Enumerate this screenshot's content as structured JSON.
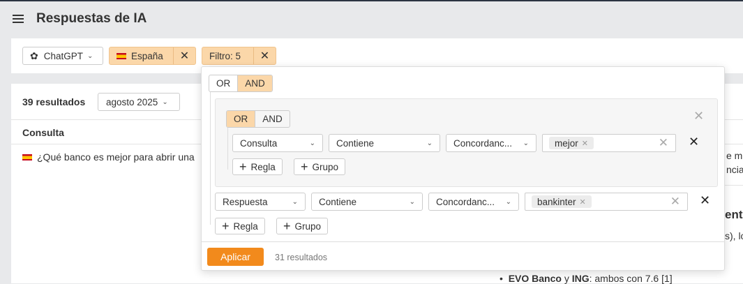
{
  "header": {
    "title": "Respuestas de IA"
  },
  "filters": {
    "model": "ChatGPT",
    "country": "España",
    "filter_label": "Filtro: 5"
  },
  "results": {
    "count": "39 resultados",
    "month": "agosto 2025",
    "column": "Consulta",
    "row_query": "¿Qué banco es mejor para abrir una"
  },
  "background_fragments": {
    "a": "e mu",
    "b": "ncia",
    "c": "ente",
    "d": "s), lo",
    "e_bold1": "EVO Banco",
    "e_mid": " y ",
    "e_bold2": "ING",
    "e_rest": ": ambos con 7.6 [1]"
  },
  "popover": {
    "outer_logic": {
      "or": "OR",
      "and": "AND",
      "selected": "AND"
    },
    "group": {
      "logic": {
        "or": "OR",
        "and": "AND",
        "selected": "OR"
      },
      "rule": {
        "field": "Consulta",
        "operator": "Contiene",
        "match": "Concordanc...",
        "value": "mejor"
      },
      "add_rule": "Regla",
      "add_group": "Grupo"
    },
    "rule": {
      "field": "Respuesta",
      "operator": "Contiene",
      "match": "Concordanc...",
      "value": "bankinter"
    },
    "add_rule": "Regla",
    "add_group": "Grupo",
    "apply": "Aplicar",
    "result_count": "31 resultados"
  }
}
